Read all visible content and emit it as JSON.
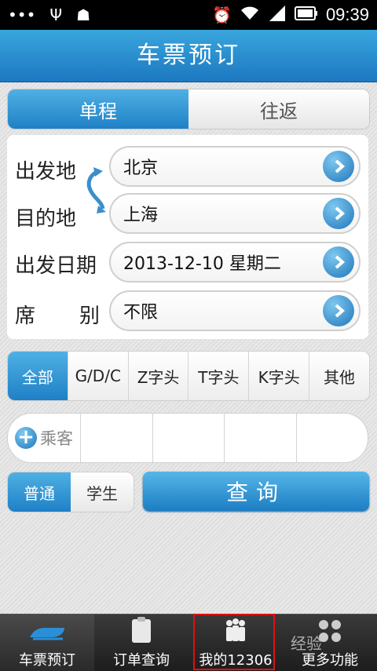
{
  "status_bar": {
    "time": "09:39"
  },
  "title": "车票预订",
  "trip_type": {
    "one_way": "单程",
    "round_trip": "往返"
  },
  "form": {
    "from_label": "出发地",
    "from_value": "北京",
    "to_label": "目的地",
    "to_value": "上海",
    "date_label": "出发日期",
    "date_value": "2013-12-10 星期二",
    "seat_label_1": "席",
    "seat_label_2": "别",
    "seat_value": "不限"
  },
  "train_types": [
    "全部",
    "G/D/C",
    "Z字头",
    "T字头",
    "K字头",
    "其他"
  ],
  "passenger": {
    "add_label": "乘客"
  },
  "ticket_type": {
    "normal": "普通",
    "student": "学生"
  },
  "query_label": "查询",
  "bottom_nav": [
    "车票预订",
    "订单查询",
    "我的12306",
    "更多功能"
  ],
  "watermark": "经验",
  "colors": {
    "accent": "#1f80c6",
    "highlight": "#e01010"
  }
}
